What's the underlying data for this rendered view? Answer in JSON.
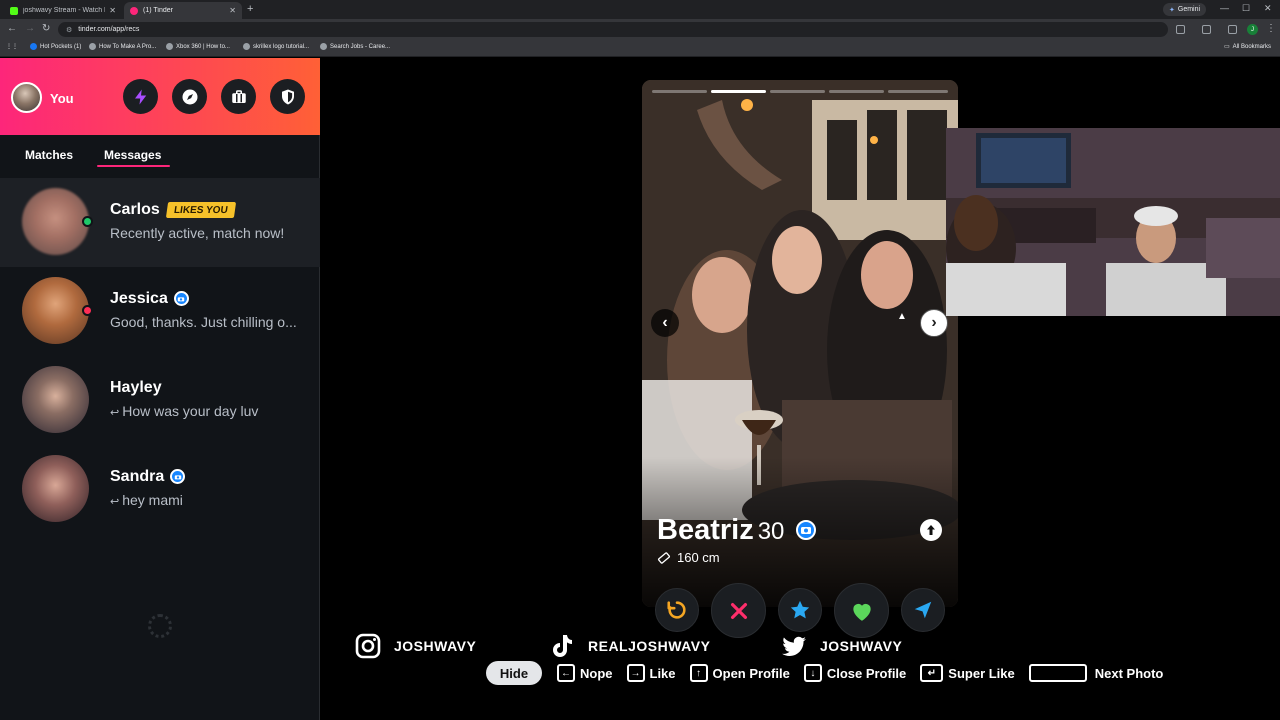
{
  "browser": {
    "tabs": [
      {
        "label": "joshwavy Stream - Watch Live o",
        "icon_color": "#53fc18"
      },
      {
        "label": "(1) Tinder",
        "icon_color": "#fd267a"
      }
    ],
    "url": "tinder.com/app/recs",
    "gemini_label": "Gemini",
    "profile_initial": "J",
    "bookmarks": [
      "Hot Pockets (1)",
      "How To Make A Pro...",
      "Xbox 360 | How to...",
      "skrillex logo tutorial...",
      "Search Jobs - Caree..."
    ],
    "all_bookmarks": "All Bookmarks"
  },
  "sidebar": {
    "you_label": "You",
    "tabs": {
      "matches": "Matches",
      "messages": "Messages"
    },
    "header_icons": [
      "lightning-icon",
      "explore-icon",
      "briefcase-icon",
      "shield-icon"
    ],
    "messages": [
      {
        "name": "Carlos",
        "preview": "Recently active, match now!",
        "badge": "LIKES YOU",
        "status": "online",
        "status_color": "#1ec969"
      },
      {
        "name": "Jessica",
        "preview": "Good, thanks. Just chilling o...",
        "verified": true,
        "status": "unread",
        "status_color": "#fd2e56"
      },
      {
        "name": "Hayley",
        "preview": "How was your day luv",
        "reply_arrow": "↩"
      },
      {
        "name": "Sandra",
        "preview": "hey mami",
        "verified": true,
        "reply_arrow": "↩"
      }
    ]
  },
  "card": {
    "name": "Beatriz",
    "age": "30",
    "height": "160 cm",
    "photo_count": 5,
    "current_photo": 2,
    "verified": true
  },
  "actions": [
    "rewind",
    "nope",
    "super-like",
    "like",
    "boost"
  ],
  "socials": [
    {
      "platform": "instagram",
      "handle": "JOSHWAVY"
    },
    {
      "platform": "tiktok",
      "handle": "REALJOSHWAVY"
    },
    {
      "platform": "twitter",
      "handle": "JOSHWAVY"
    }
  ],
  "hints": {
    "hide": "Hide",
    "nope": "Nope",
    "like": "Like",
    "open_profile": "Open Profile",
    "close_profile": "Close Profile",
    "super_like": "Super Like",
    "next_photo": "Next Photo"
  },
  "colors": {
    "brand_gradient_start": "#fd267a",
    "brand_gradient_end": "#ff6036",
    "likes_badge": "#f6c12a",
    "verified_blue": "#1786ff"
  }
}
